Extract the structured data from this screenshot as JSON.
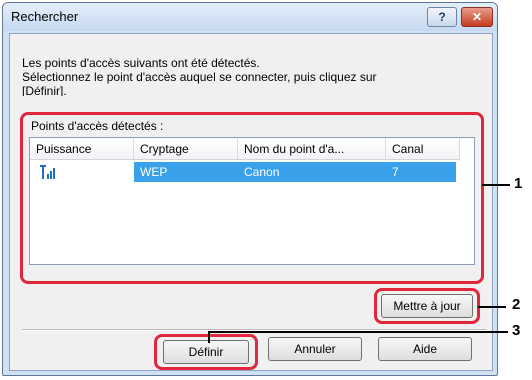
{
  "window": {
    "title": "Rechercher",
    "help_label": "?",
    "close_label": "✕"
  },
  "instructions": {
    "line1": "Les points d'accès suivants ont été détectés.",
    "line2": "Sélectionnez le point d'accès auquel se connecter, puis cliquez sur",
    "line3": "[Définir]."
  },
  "group": {
    "label": "Points d'accès détectés :"
  },
  "table": {
    "columns": [
      "Puissance",
      "Cryptage",
      "Nom du point d'a...",
      "Canal"
    ],
    "rows": [
      {
        "signal_icon": "signal-strength-icon",
        "encryption": "WEP",
        "name": "Canon",
        "channel": "7"
      }
    ]
  },
  "buttons": {
    "refresh": "Mettre à jour",
    "set": "Définir",
    "cancel": "Annuler",
    "help": "Aide"
  },
  "callouts": [
    "1",
    "2",
    "3"
  ],
  "colors": {
    "highlight": "#e2263c",
    "selection": "#39a1ea"
  }
}
